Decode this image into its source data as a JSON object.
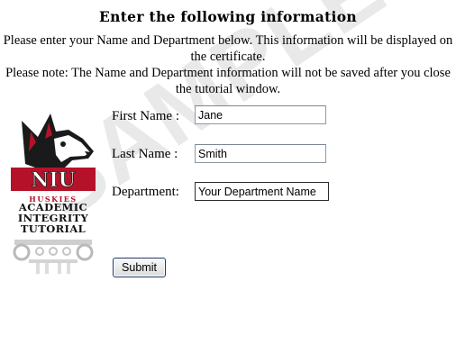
{
  "header": {
    "title": "Enter the following information",
    "instructions": "Please enter your Name and Department below. This information will be displayed on the certificate.",
    "note": "Please note: The Name and Department information will not be saved after you close the tutorial window."
  },
  "form": {
    "first_name": {
      "label": "First Name :",
      "value": "Jane"
    },
    "last_name": {
      "label": "Last Name :",
      "value": "Smith"
    },
    "department": {
      "label": "Department:",
      "value": "Your Department Name"
    },
    "submit_label": "Submit"
  },
  "logo": {
    "icon": "husky-head-icon",
    "brand": "NIU",
    "team": "HUSKIES",
    "line1": "ACADEMIC",
    "line2": "INTEGRITY",
    "line3": "TUTORIAL"
  },
  "watermark": {
    "text": "SAMPLE",
    "color": "#e9e9e9"
  },
  "colors": {
    "brand_red": "#b5122a",
    "input_border": "#8c9aa8",
    "button_border": "#1f3a68"
  }
}
